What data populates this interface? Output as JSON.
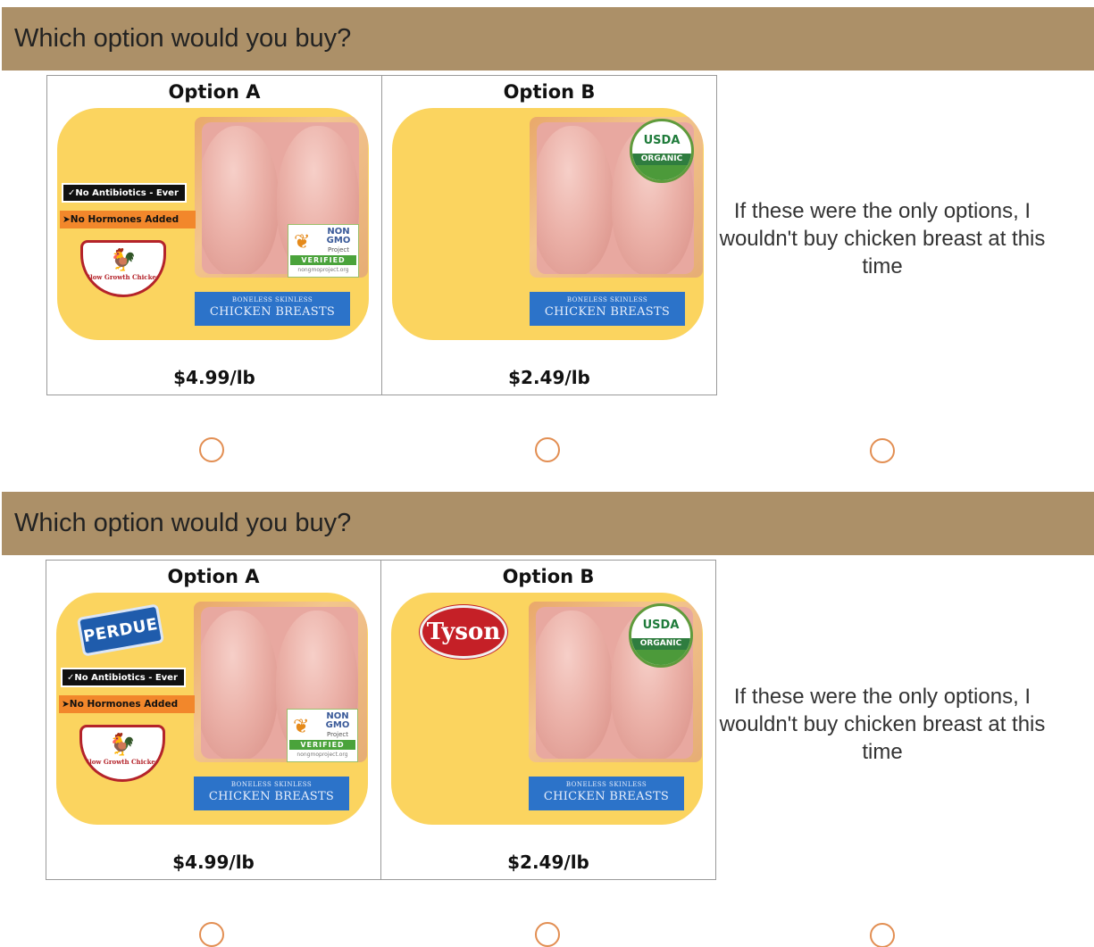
{
  "questions": [
    {
      "prompt": "Which option would you buy?",
      "option_a": {
        "title": "Option A",
        "price": "$4.99/lb",
        "brand": "",
        "claims": [
          "✓No Antibiotics - Ever",
          "➤No Hormones Added"
        ],
        "slow_growth": "Slow Growth Chicken",
        "non_gmo": [
          "NON",
          "GMO",
          "Project",
          "VERIFIED",
          "nongmoproject.org"
        ],
        "usda": false,
        "package_label": [
          "BONELESS SKINLESS",
          "CHICKEN BREASTS"
        ]
      },
      "option_b": {
        "title": "Option B",
        "price": "$2.49/lb",
        "brand": "",
        "usda": [
          "USDA",
          "ORGANIC"
        ],
        "package_label": [
          "BONELESS SKINLESS",
          "CHICKEN BREASTS"
        ]
      },
      "none_option": "If these were the only options, I wouldn't buy chicken breast at this time"
    },
    {
      "prompt": "Which option would you buy?",
      "option_a": {
        "title": "Option A",
        "price": "$4.99/lb",
        "brand": "PERDUE",
        "claims": [
          "✓No Antibiotics - Ever",
          "➤No Hormones Added"
        ],
        "slow_growth": "Slow Growth Chicken",
        "non_gmo": [
          "NON",
          "GMO",
          "Project",
          "VERIFIED",
          "nongmoproject.org"
        ],
        "usda": false,
        "package_label": [
          "BONELESS SKINLESS",
          "CHICKEN BREASTS"
        ]
      },
      "option_b": {
        "title": "Option B",
        "price": "$2.49/lb",
        "brand": "Tyson",
        "usda": [
          "USDA",
          "ORGANIC"
        ],
        "package_label": [
          "BONELESS SKINLESS",
          "CHICKEN BREASTS"
        ]
      },
      "none_option": "If these were the only options, I wouldn't buy chicken breast at this time"
    }
  ],
  "colors": {
    "header": "#ac9068",
    "package": "#fbd45f",
    "label_band": "#2c73c9",
    "radio_border": "#e28e52"
  }
}
